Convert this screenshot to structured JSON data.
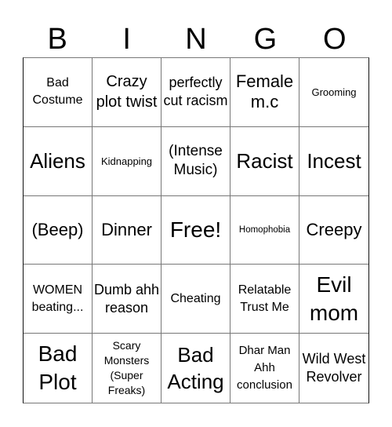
{
  "header": {
    "letters": [
      "B",
      "I",
      "N",
      "G",
      "O"
    ]
  },
  "cells": [
    "Bad Costume",
    "Crazy plot twist",
    "perfectly cut racism",
    "Female m.c",
    "Grooming",
    "Aliens",
    "Kidnapping",
    "(Intense Music)",
    "Racist",
    "Incest",
    "(Beep)",
    "Dinner",
    "Free!",
    "Homophobia",
    "Creepy",
    "WOMEN beating...",
    "Dumb ahh reason",
    "Cheating",
    "Relatable Trust Me",
    "Evil mom",
    "Bad Plot",
    "Scary Monsters (Super Freaks)",
    "Bad Acting",
    "Dhar Man Ahh conclusion",
    "Wild West Revolver"
  ],
  "free_space": {
    "index": 12,
    "label": "Free!"
  }
}
